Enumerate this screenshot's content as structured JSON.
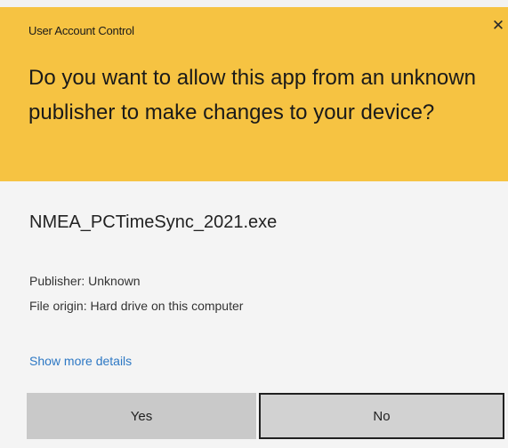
{
  "dialog": {
    "header_title": "User Account Control",
    "close_glyph": "✕",
    "question": "Do you want to allow this app from an unknown publisher to make changes to your device?",
    "app_name": "NMEA_PCTimeSync_2021.exe",
    "publisher": "Publisher: Unknown",
    "file_origin": "File origin: Hard drive on this computer",
    "show_more_link": "Show more details",
    "yes_label": "Yes",
    "no_label": "No"
  },
  "colors": {
    "header_background": "#f6c342",
    "body_background": "#f4f4f4",
    "link": "#2d78c4",
    "button": "#c9c9c9"
  },
  "icons": {
    "close": "close-icon"
  }
}
